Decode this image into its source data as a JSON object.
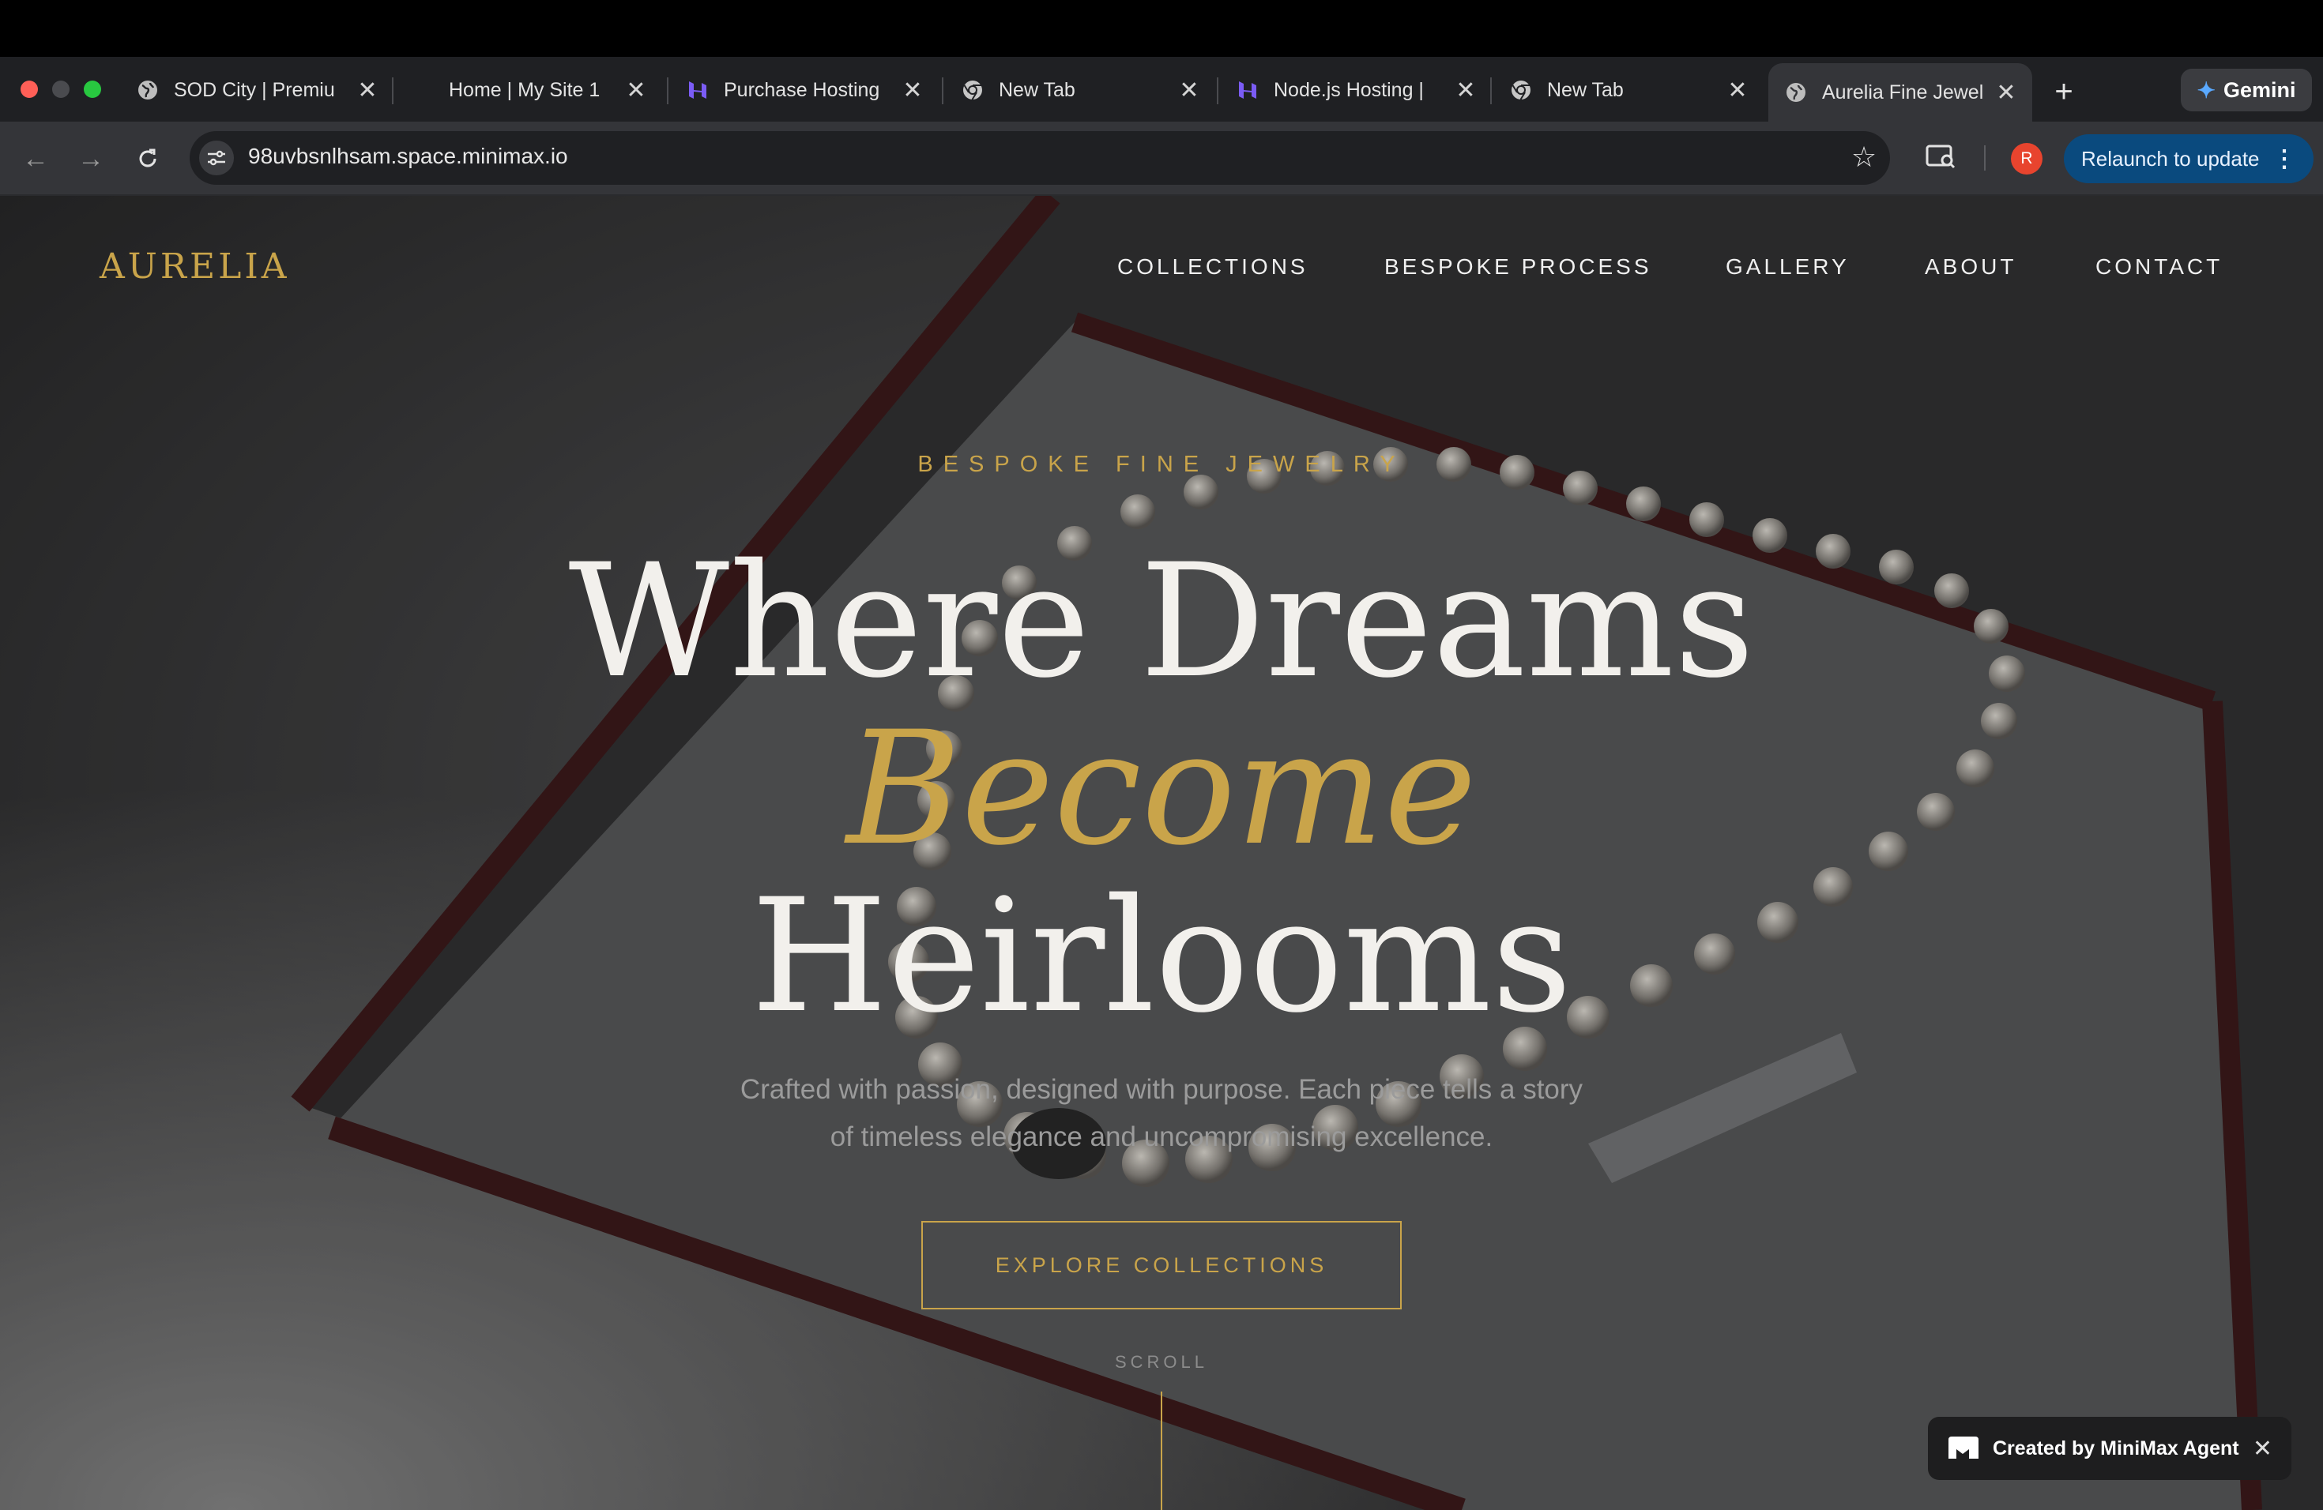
{
  "browser": {
    "tabs": [
      {
        "title": "SOD City | Premiu",
        "icon": "globe-icon"
      },
      {
        "title": "Home | My Site 1",
        "icon": "blank-icon"
      },
      {
        "title": "Purchase Hosting",
        "icon": "hostinger-icon"
      },
      {
        "title": "New Tab",
        "icon": "chrome-icon"
      },
      {
        "title": "Node.js Hosting | ",
        "icon": "hostinger-icon"
      },
      {
        "title": "New Tab",
        "icon": "chrome-icon"
      },
      {
        "title": "Aurelia Fine Jewel",
        "icon": "globe-icon",
        "active": true
      }
    ],
    "close_glyph": "✕",
    "new_tab_glyph": "+",
    "gemini_label": "Gemini",
    "url": "98uvbsnlhsam.space.minimax.io",
    "avatar_initial": "R",
    "relaunch_label": "Relaunch to update",
    "relaunch_menu": "⋮",
    "colors": {
      "accent": "#c9a44a",
      "relaunch": "#0a4a7e"
    }
  },
  "site": {
    "logo": "AURELIA",
    "nav": [
      "COLLECTIONS",
      "BESPOKE PROCESS",
      "GALLERY",
      "ABOUT",
      "CONTACT"
    ],
    "hero": {
      "eyebrow": "BESPOKE FINE JEWELRY",
      "line1": "Where Dreams",
      "line2": "Become",
      "line3": "Heirlooms",
      "tagline1": "Crafted with passion, designed with purpose. Each piece tells a story",
      "tagline2": "of timeless elegance and uncompromising excellence.",
      "cta": "EXPLORE COLLECTIONS",
      "scroll": "SCROLL"
    },
    "badge": {
      "label": "Created by MiniMax Agent",
      "close": "✕"
    }
  }
}
